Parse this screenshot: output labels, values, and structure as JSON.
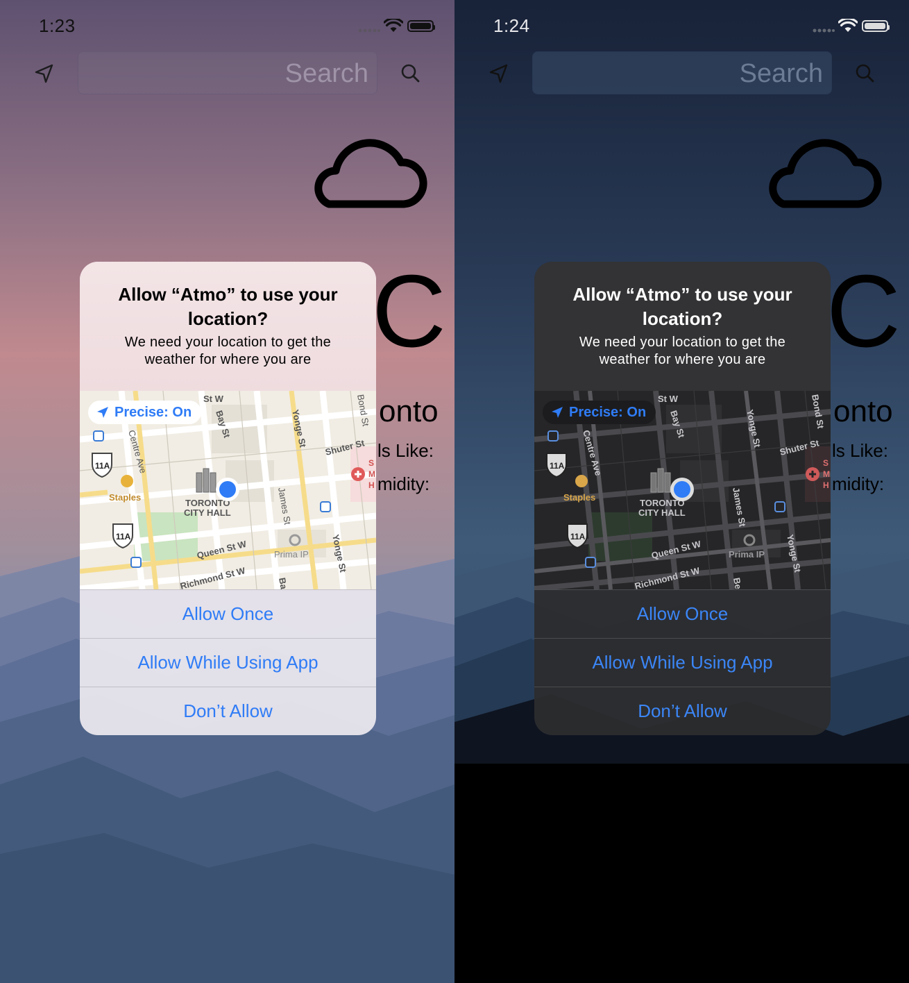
{
  "app": {
    "name": "Atmo"
  },
  "colors": {
    "accent": "#2f7cf6",
    "user_location": "#2f7cf6"
  },
  "screens": [
    {
      "theme": "light",
      "status_bar": {
        "time": "1:23"
      },
      "search": {
        "placeholder": "Search"
      },
      "weather": {
        "condition_icon": "cloud-icon",
        "temp_fragment": "C",
        "city_fragment": "onto",
        "feels_like_fragment": "ls Like:",
        "humidity_fragment": "midity:"
      },
      "dialog": {
        "title": "Allow “Atmo” to use your location?",
        "message": "We need your location to get the weather for where you are",
        "precise": "Precise: On",
        "map_labels": [
          "St W",
          "Bay St",
          "Yonge St",
          "Bond St",
          "Shuter St",
          "Centre Ave",
          "Staples",
          "TORONTO",
          "CITY HALL",
          "James St",
          "Queen St W",
          "Prima IP",
          "Yonge St",
          "Richmond St W",
          "11A",
          "11A",
          "Ba",
          "S",
          "M",
          "H"
        ],
        "buttons": {
          "allow_once": "Allow Once",
          "allow_while_using": "Allow While Using App",
          "dont_allow": "Don’t Allow"
        }
      }
    },
    {
      "theme": "dark",
      "status_bar": {
        "time": "1:24"
      },
      "search": {
        "placeholder": "Search"
      },
      "weather": {
        "condition_icon": "cloud-icon",
        "temp_fragment": "C",
        "city_fragment": "onto",
        "feels_like_fragment": "ls Like:",
        "humidity_fragment": "midity:"
      },
      "dialog": {
        "title": "Allow “Atmo” to use your location?",
        "message": "We need your location to get the weather for where you are",
        "precise": "Precise: On",
        "map_labels": [
          "St W",
          "Bay St",
          "Yonge St",
          "Bond St",
          "Shuter St",
          "Centre Ave",
          "Staples",
          "TORONTO",
          "CITY HALL",
          "James St",
          "Queen St W",
          "Prima IP",
          "Yonge St",
          "Richmond St W",
          "11A",
          "11A",
          "Be",
          "S",
          "M",
          "H"
        ],
        "buttons": {
          "allow_once": "Allow Once",
          "allow_while_using": "Allow While Using App",
          "dont_allow": "Don’t Allow"
        }
      }
    }
  ]
}
